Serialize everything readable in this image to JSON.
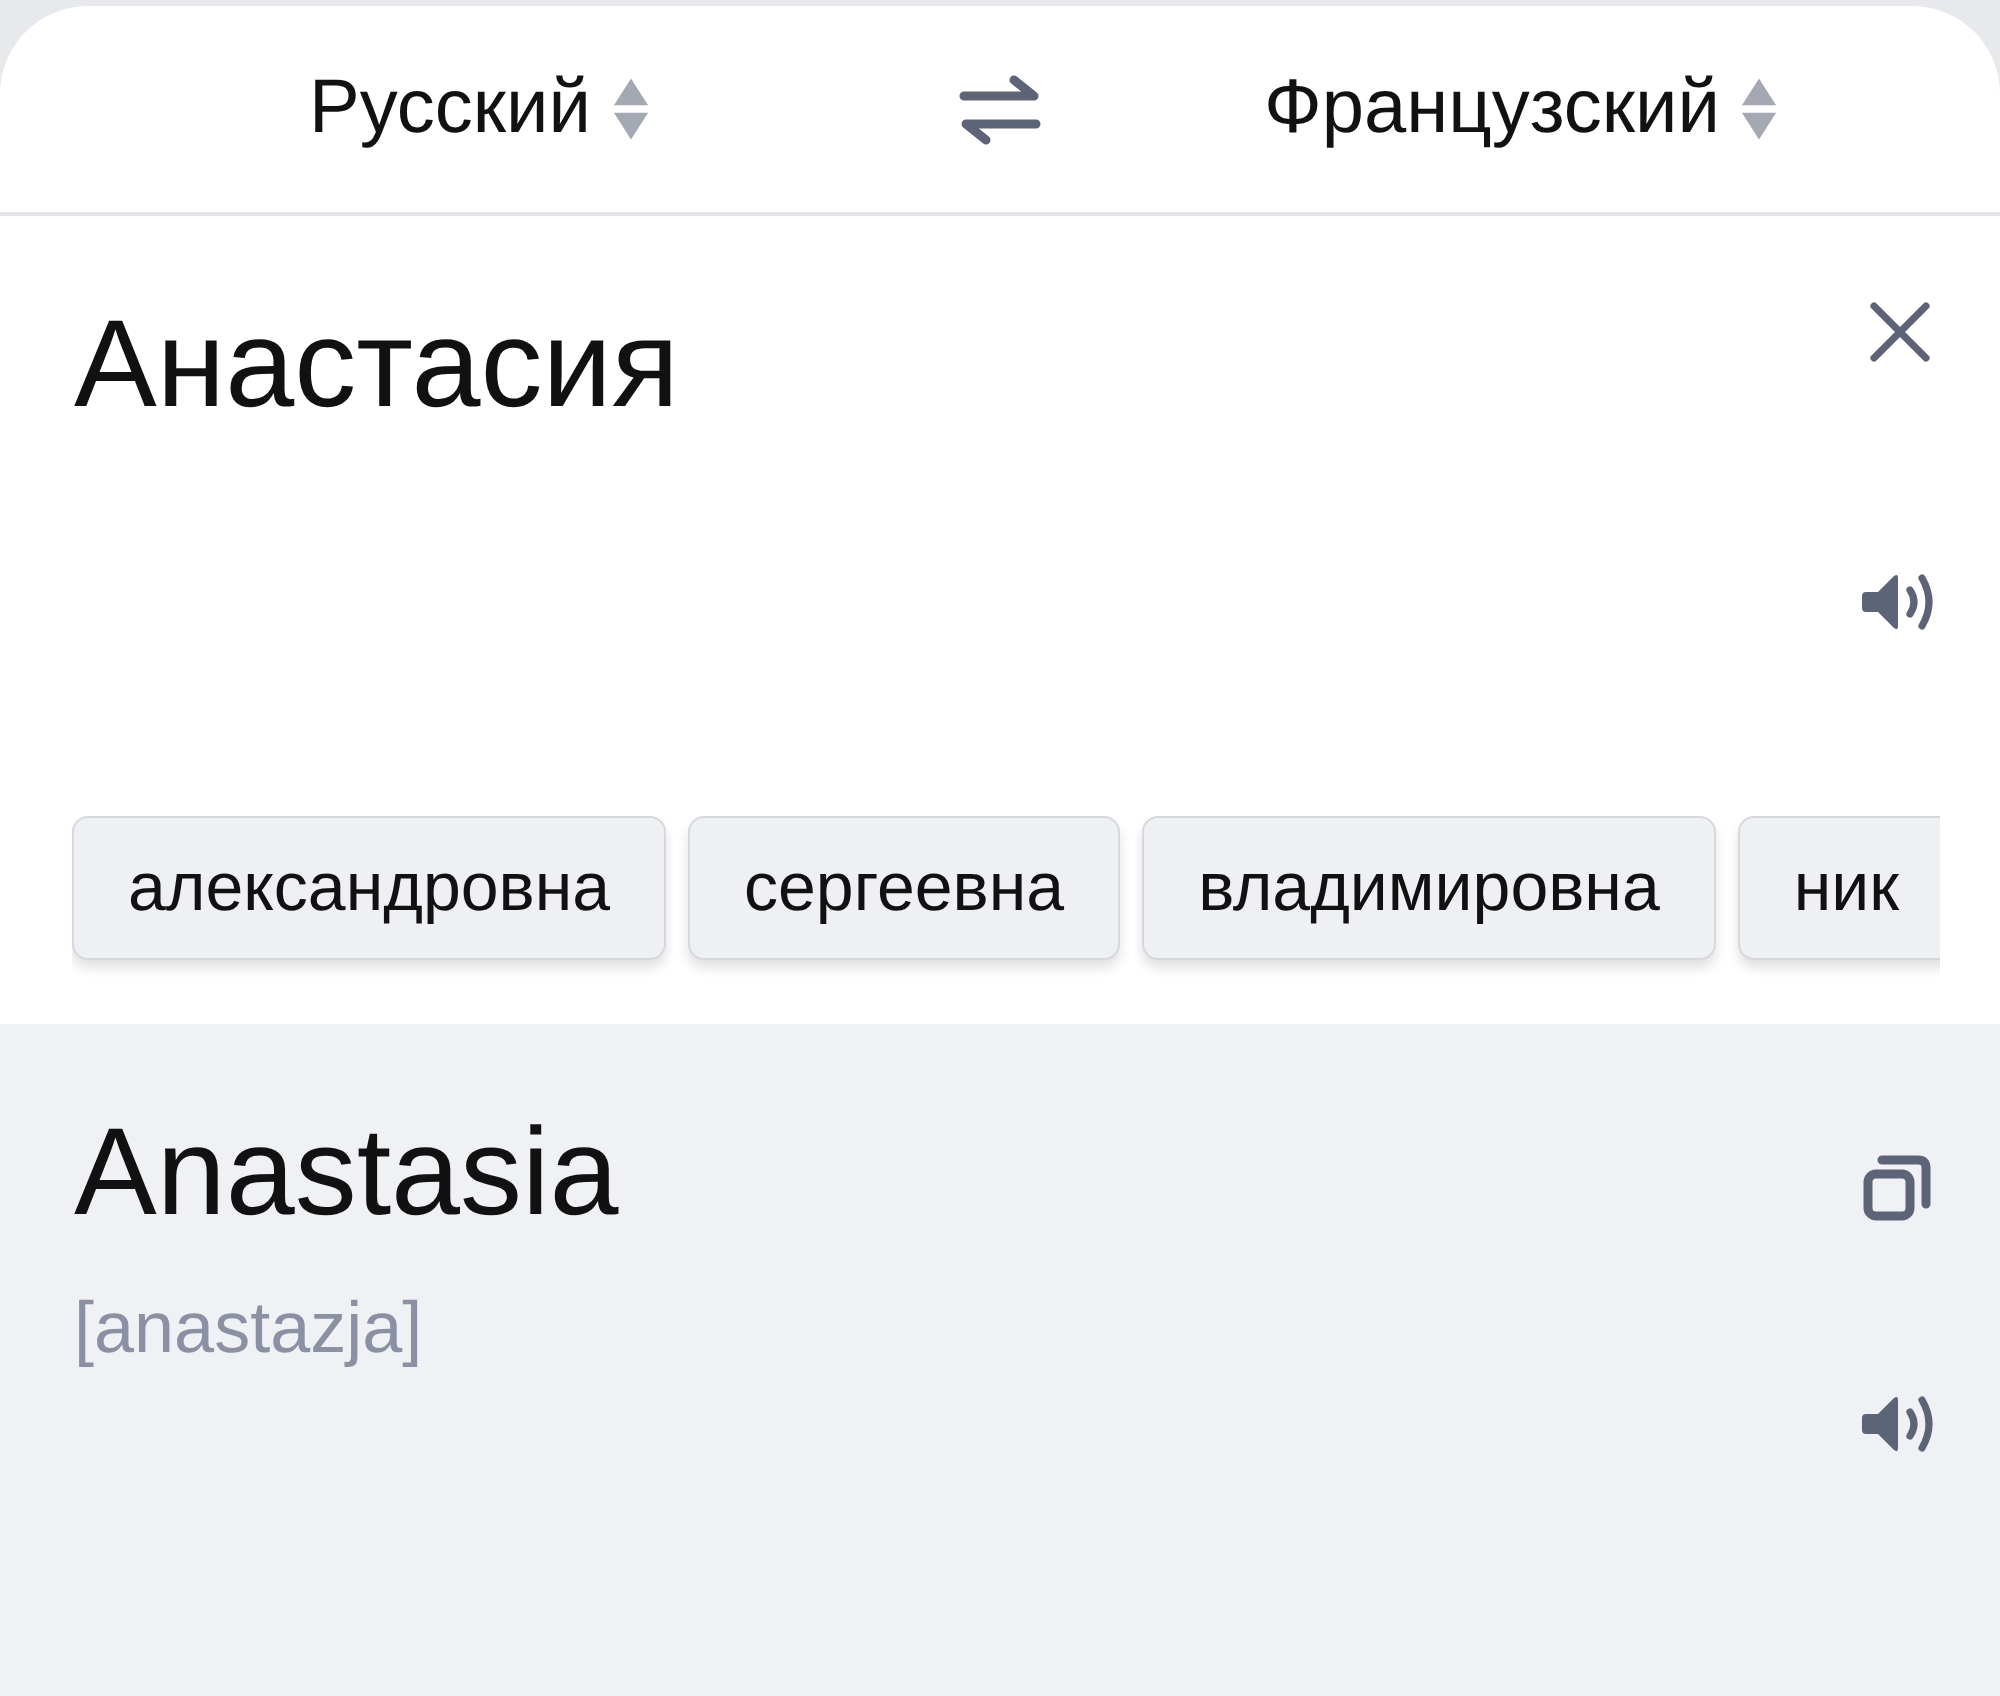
{
  "language_bar": {
    "source": {
      "label": "Русский"
    },
    "target": {
      "label": "Французский"
    }
  },
  "input": {
    "value": "Анастасия"
  },
  "suggestions": [
    {
      "label": "александровна"
    },
    {
      "label": "сергеевна"
    },
    {
      "label": "владимировна"
    },
    {
      "label": "ник"
    }
  ],
  "output": {
    "translation": "Anastasia",
    "transcription": "[anastazja]"
  }
}
